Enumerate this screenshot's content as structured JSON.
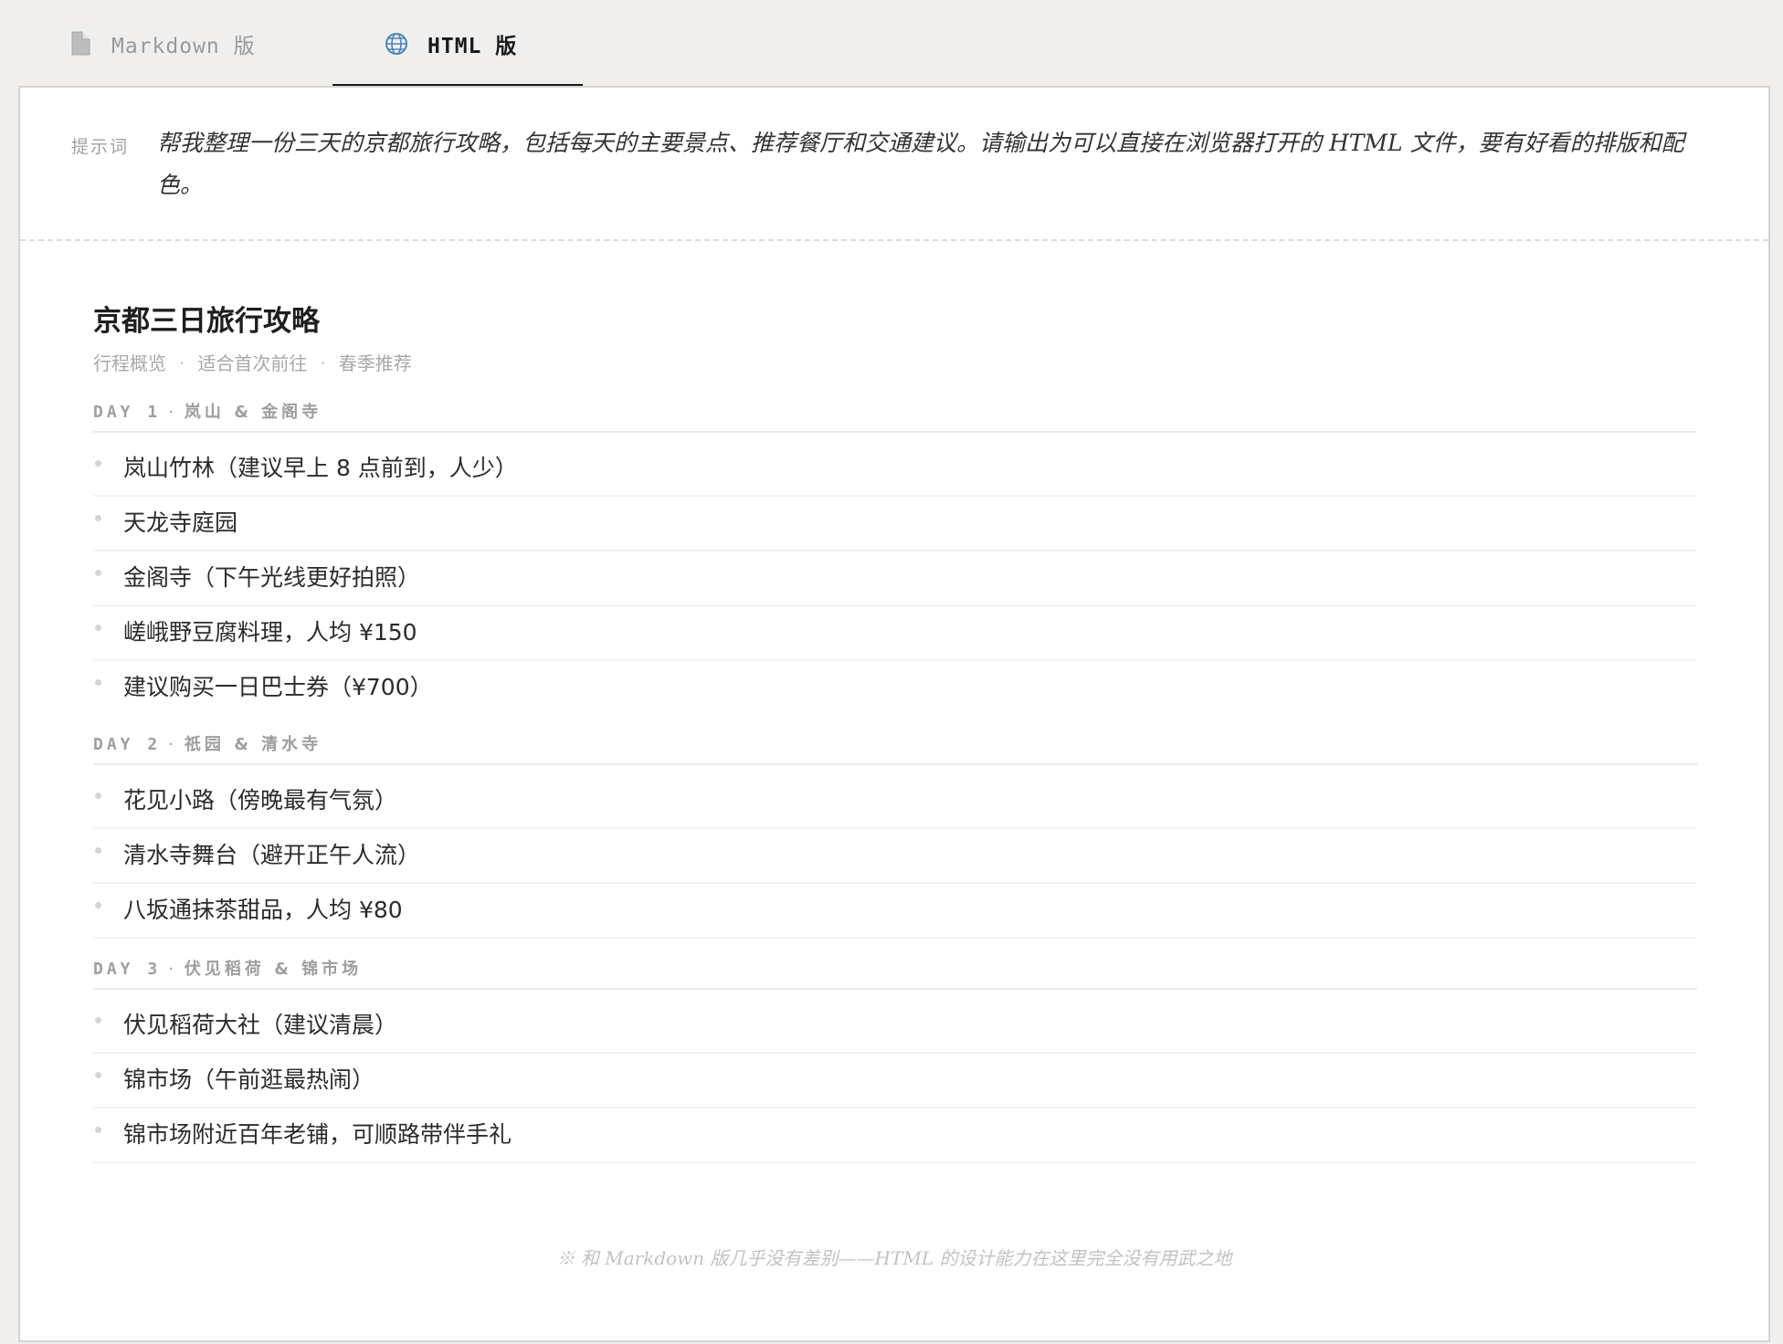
{
  "tabs": [
    {
      "label": "Markdown 版",
      "icon": "document-icon",
      "active": false
    },
    {
      "label": "HTML 版",
      "icon": "globe-icon",
      "active": true
    }
  ],
  "prompt": {
    "label": "提示词",
    "text": "帮我整理一份三天的京都旅行攻略，包括每天的主要景点、推荐餐厅和交通建议。请输出为可以直接在浏览器打开的 HTML 文件，要有好看的排版和配色。"
  },
  "doc": {
    "title": "京都三日旅行攻略",
    "meta": [
      "行程概览",
      "适合首次前往",
      "春季推荐"
    ],
    "meta_sep": "·",
    "days": [
      {
        "code": "DAY 1",
        "sep": "·",
        "title": "岚山 & 金阁寺",
        "items": [
          "岚山竹林（建议早上 8 点前到，人少）",
          "天龙寺庭园",
          "金阁寺（下午光线更好拍照）",
          "嵯峨野豆腐料理，人均 ¥150",
          "建议购买一日巴士券（¥700）"
        ]
      },
      {
        "code": "DAY 2",
        "sep": "·",
        "title": "祇园 & 清水寺",
        "items": [
          "花见小路（傍晚最有气氛）",
          "清水寺舞台（避开正午人流）",
          "八坂通抹茶甜品，人均 ¥80"
        ]
      },
      {
        "code": "DAY 3",
        "sep": "·",
        "title": "伏见稻荷 & 锦市场",
        "items": [
          "伏见稻荷大社（建议清晨）",
          "锦市场（午前逛最热闹）",
          "锦市场附近百年老铺，可顺路带伴手礼"
        ]
      }
    ]
  },
  "footnote": "※ 和 Markdown 版几乎没有差别——HTML 的设计能力在这里完全没有用武之地",
  "colors": {
    "page_bg": "#f0efee",
    "panel_bg": "#ffffff",
    "text": "#2b2b2b",
    "muted": "#a8a8a8",
    "active_underline": "#1a1a1a",
    "globe": "#4a86b8"
  }
}
